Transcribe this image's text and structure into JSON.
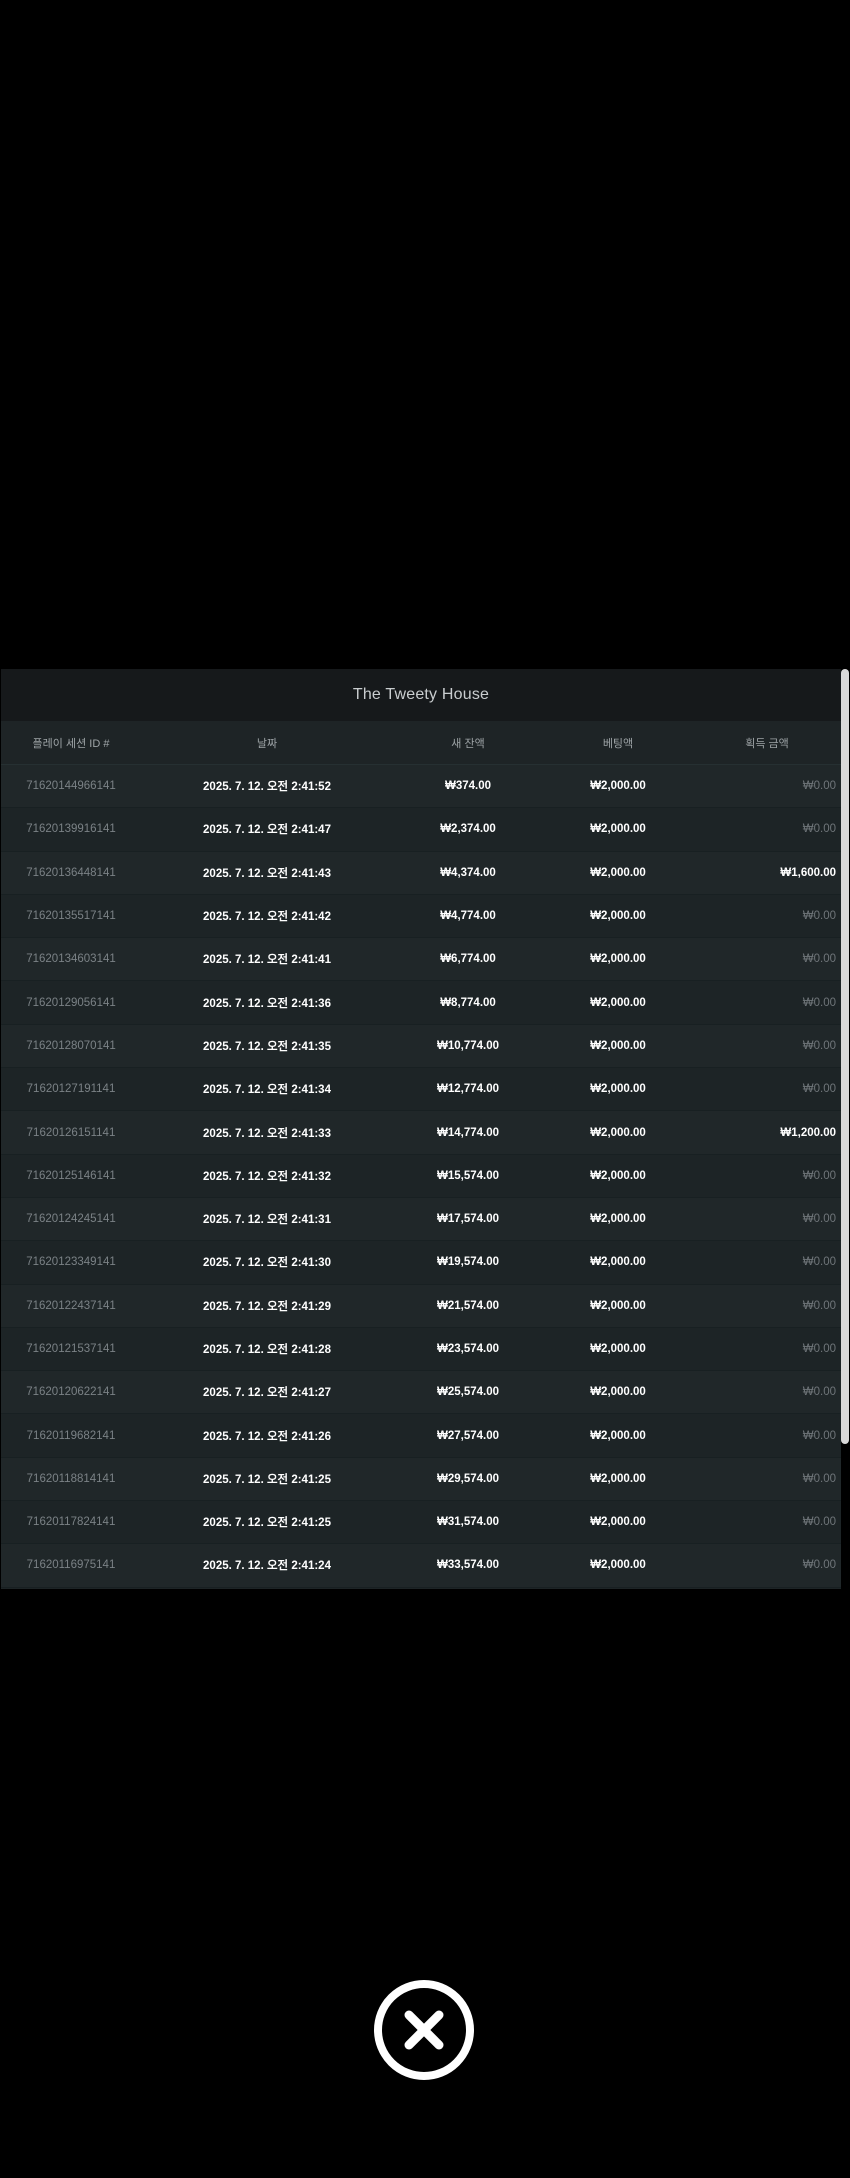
{
  "panel": {
    "title": "The Tweety House"
  },
  "columns": [
    "플레이 세션 ID #",
    "날짜",
    "새 잔액",
    "베팅액",
    "획득 금액"
  ],
  "rows": [
    {
      "id": "716201449661​41",
      "date": "2025. 7. 12. 오전 2:41:52",
      "balance": "₩374.00",
      "bet": "₩2,000.00",
      "win": "₩0.00"
    },
    {
      "id": "71620139916141",
      "date": "2025. 7. 12. 오전 2:41:47",
      "balance": "₩2,374.00",
      "bet": "₩2,000.00",
      "win": "₩0.00"
    },
    {
      "id": "71620136448141",
      "date": "2025. 7. 12. 오전 2:41:43",
      "balance": "₩4,374.00",
      "bet": "₩2,000.00",
      "win": "₩1,600.00"
    },
    {
      "id": "71620135517141",
      "date": "2025. 7. 12. 오전 2:41:42",
      "balance": "₩4,774.00",
      "bet": "₩2,000.00",
      "win": "₩0.00"
    },
    {
      "id": "71620134603141",
      "date": "2025. 7. 12. 오전 2:41:41",
      "balance": "₩6,774.00",
      "bet": "₩2,000.00",
      "win": "₩0.00"
    },
    {
      "id": "71620129056141",
      "date": "2025. 7. 12. 오전 2:41:36",
      "balance": "₩8,774.00",
      "bet": "₩2,000.00",
      "win": "₩0.00"
    },
    {
      "id": "71620128070141",
      "date": "2025. 7. 12. 오전 2:41:35",
      "balance": "₩10,774.00",
      "bet": "₩2,000.00",
      "win": "₩0.00"
    },
    {
      "id": "71620127191141",
      "date": "2025. 7. 12. 오전 2:41:34",
      "balance": "₩12,774.00",
      "bet": "₩2,000.00",
      "win": "₩0.00"
    },
    {
      "id": "71620126151141",
      "date": "2025. 7. 12. 오전 2:41:33",
      "balance": "₩14,774.00",
      "bet": "₩2,000.00",
      "win": "₩1,200.00"
    },
    {
      "id": "71620125146141",
      "date": "2025. 7. 12. 오전 2:41:32",
      "balance": "₩15,574.00",
      "bet": "₩2,000.00",
      "win": "₩0.00"
    },
    {
      "id": "71620124245141",
      "date": "2025. 7. 12. 오전 2:41:31",
      "balance": "₩17,574.00",
      "bet": "₩2,000.00",
      "win": "₩0.00"
    },
    {
      "id": "71620123349141",
      "date": "2025. 7. 12. 오전 2:41:30",
      "balance": "₩19,574.00",
      "bet": "₩2,000.00",
      "win": "₩0.00"
    },
    {
      "id": "71620122437141",
      "date": "2025. 7. 12. 오전 2:41:29",
      "balance": "₩21,574.00",
      "bet": "₩2,000.00",
      "win": "₩0.00"
    },
    {
      "id": "71620121537141",
      "date": "2025. 7. 12. 오전 2:41:28",
      "balance": "₩23,574.00",
      "bet": "₩2,000.00",
      "win": "₩0.00"
    },
    {
      "id": "71620120622141",
      "date": "2025. 7. 12. 오전 2:41:27",
      "balance": "₩25,574.00",
      "bet": "₩2,000.00",
      "win": "₩0.00"
    },
    {
      "id": "71620119682141",
      "date": "2025. 7. 12. 오전 2:41:26",
      "balance": "₩27,574.00",
      "bet": "₩2,000.00",
      "win": "₩0.00"
    },
    {
      "id": "71620118814141",
      "date": "2025. 7. 12. 오전 2:41:25",
      "balance": "₩29,574.00",
      "bet": "₩2,000.00",
      "win": "₩0.00"
    },
    {
      "id": "71620117824141",
      "date": "2025. 7. 12. 오전 2:41:25",
      "balance": "₩31,574.00",
      "bet": "₩2,000.00",
      "win": "₩0.00"
    },
    {
      "id": "71620116975141",
      "date": "2025. 7. 12. 오전 2:41:24",
      "balance": "₩33,574.00",
      "bet": "₩2,000.00",
      "win": "₩0.00"
    }
  ],
  "close_button": {
    "icon": "close-x-icon"
  }
}
